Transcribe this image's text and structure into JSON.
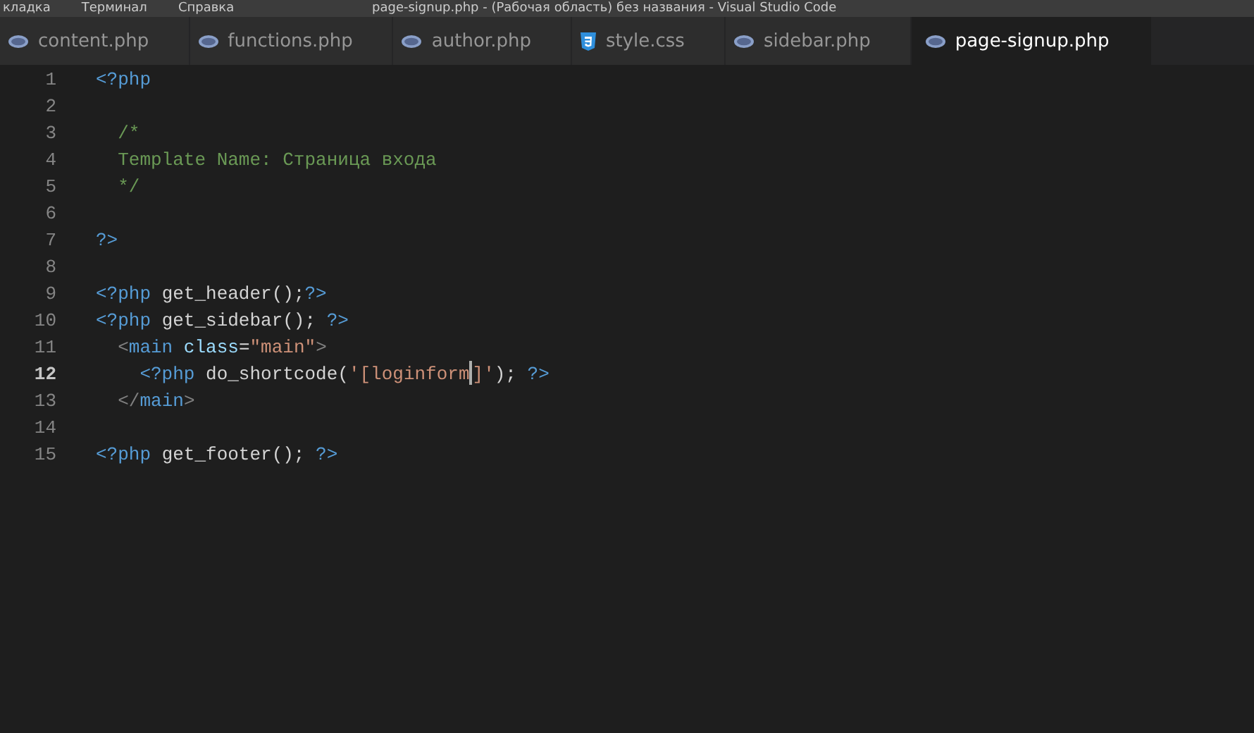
{
  "title_bar": {
    "menu": [
      "кладка",
      "Терминал",
      "Справка"
    ],
    "title": "page-signup.php - (Рабочая область) без названия - Visual Studio Code"
  },
  "tabs": [
    {
      "label": "content.php",
      "kind": "php",
      "selected": false
    },
    {
      "label": "functions.php",
      "kind": "php",
      "selected": false
    },
    {
      "label": "author.php",
      "kind": "php",
      "selected": false
    },
    {
      "label": "style.css",
      "kind": "css",
      "selected": false
    },
    {
      "label": "sidebar.php",
      "kind": "php",
      "selected": false
    },
    {
      "label": "page-signup.php",
      "kind": "php",
      "selected": true
    }
  ],
  "editor": {
    "lines": [
      {
        "number": "1",
        "current": false,
        "tokens": [
          {
            "kind": "tag",
            "text": "<?php"
          }
        ]
      },
      {
        "number": "2",
        "current": false
      },
      {
        "number": "3",
        "current": false,
        "tokens": [
          {
            "kind": "comment",
            "text": "  /*"
          }
        ]
      },
      {
        "number": "4",
        "current": false,
        "tokens": [
          {
            "kind": "comment",
            "text": "  Template Name: Страница входа"
          }
        ]
      },
      {
        "number": "5",
        "current": false,
        "tokens": [
          {
            "kind": "comment",
            "text": "  */"
          }
        ]
      },
      {
        "number": "6",
        "current": false
      },
      {
        "number": "7",
        "current": false,
        "tokens": [
          {
            "kind": "tag",
            "text": "?>"
          }
        ]
      },
      {
        "number": "8",
        "current": false
      },
      {
        "number": "9",
        "current": false,
        "tokens": [
          {
            "kind": "tag",
            "text": "<?php"
          },
          {
            "kind": "plain",
            "text": " get_header();"
          },
          {
            "kind": "tag",
            "text": "?>"
          }
        ]
      },
      {
        "number": "10",
        "current": false,
        "tokens": [
          {
            "kind": "tag",
            "text": "<?php"
          },
          {
            "kind": "plain",
            "text": " get_sidebar(); "
          },
          {
            "kind": "tag",
            "text": "?>"
          }
        ]
      },
      {
        "number": "11",
        "current": false,
        "tokens": [
          {
            "kind": "punct",
            "text": "  <"
          },
          {
            "kind": "tag",
            "text": "main"
          },
          {
            "kind": "attr",
            "text": " class"
          },
          {
            "kind": "plain",
            "text": "="
          },
          {
            "kind": "string",
            "text": "\"main\""
          },
          {
            "kind": "punct",
            "text": ">"
          }
        ]
      },
      {
        "number": "12",
        "current": true,
        "tokens": [
          {
            "kind": "tag",
            "text": "    <?php"
          },
          {
            "kind": "plain",
            "text": " do_shortcode("
          },
          {
            "kind": "string",
            "text": "'[loginform",
            "caret": true
          },
          {
            "kind": "string",
            "text": "]'"
          },
          {
            "kind": "plain",
            "text": "); "
          },
          {
            "kind": "tag",
            "text": "?>"
          }
        ]
      },
      {
        "number": "13",
        "current": false,
        "tokens": [
          {
            "kind": "punct",
            "text": "  </"
          },
          {
            "kind": "tag",
            "text": "main"
          },
          {
            "kind": "punct",
            "text": ">"
          }
        ]
      },
      {
        "number": "14",
        "current": false
      },
      {
        "number": "15",
        "current": false,
        "tokens": [
          {
            "kind": "tag",
            "text": "<?php"
          },
          {
            "kind": "plain",
            "text": " get_footer(); "
          },
          {
            "kind": "tag",
            "text": "?>"
          }
        ]
      }
    ]
  }
}
